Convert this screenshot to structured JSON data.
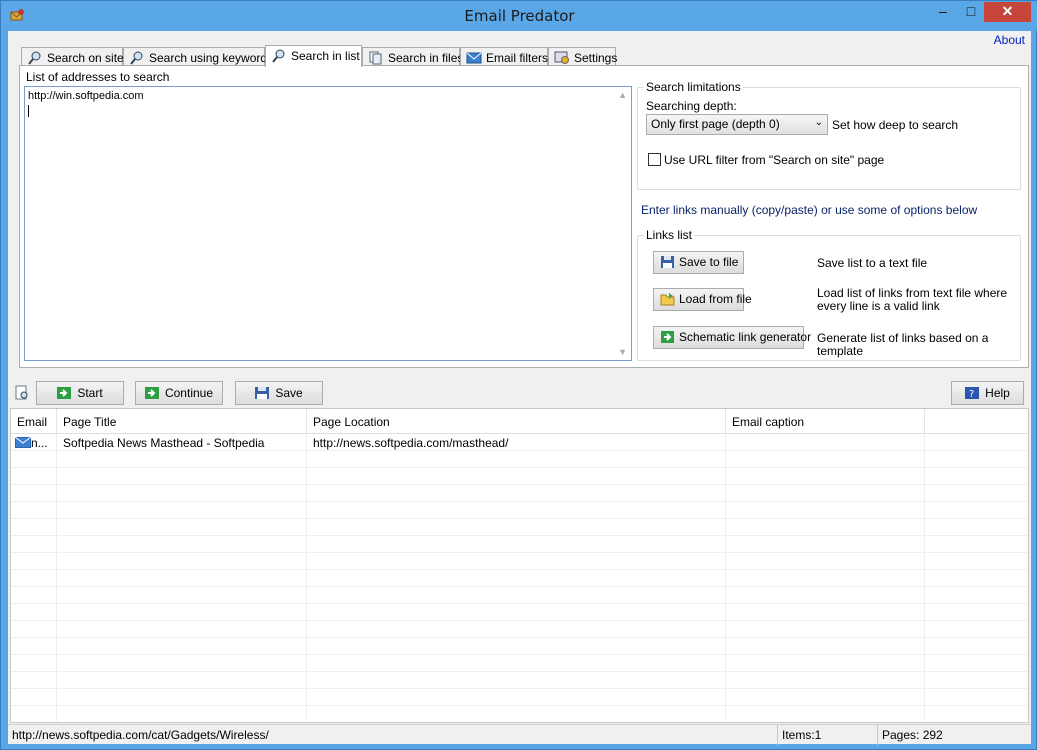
{
  "window": {
    "title": "Email Predator"
  },
  "menu": {
    "about": "About"
  },
  "tabs": [
    {
      "label": "Search on site"
    },
    {
      "label": "Search using keywords"
    },
    {
      "label": "Search in list"
    },
    {
      "label": "Search in files"
    },
    {
      "label": "Email filters"
    },
    {
      "label": "Settings"
    }
  ],
  "panel": {
    "list_label": "List of addresses to search",
    "addresses": "http://win.softpedia.com",
    "search_limitations": {
      "legend": "Search limitations",
      "depth_label": "Searching depth:",
      "depth_value": "Only first page (depth 0)",
      "depth_hint": "Set how deep to search",
      "url_filter_label": "Use URL filter from \"Search on site\" page",
      "url_filter_checked": false
    },
    "hint": "Enter links manually (copy/paste) or use some of options below",
    "links_list": {
      "legend": "Links list",
      "save_to_file": "Save to file",
      "save_desc": "Save list to a text file",
      "load_from_file": "Load from file",
      "load_desc": "Load list of links from text file where every line is a valid link",
      "schematic": "Schematic link generator",
      "schematic_desc": "Generate list of links based on a template"
    }
  },
  "toolbar": {
    "start": "Start",
    "continue": "Continue",
    "save": "Save",
    "help": "Help"
  },
  "results": {
    "columns": [
      "Email",
      "Page Title",
      "Page Location",
      "Email caption"
    ],
    "rows": [
      {
        "email": "n...",
        "title": "Softpedia News Masthead - Softpedia",
        "location": "http://news.softpedia.com/masthead/",
        "caption": ""
      }
    ]
  },
  "status": {
    "url": "http://news.softpedia.com/cat/Gadgets/Wireless/",
    "items": "Items:1",
    "pages": "Pages: 292"
  },
  "colors": {
    "titlebar": "#5aa7e8",
    "close": "#c7463b",
    "link": "#0020c0",
    "hint": "#0a246a"
  }
}
